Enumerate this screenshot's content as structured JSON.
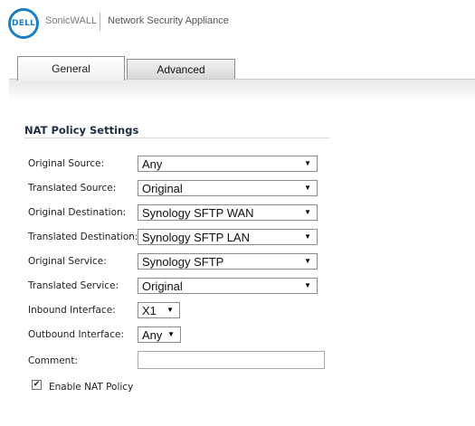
{
  "header": {
    "logo_text": "DELL",
    "brand": "SonicWALL",
    "product": "Network Security Appliance"
  },
  "tabs": [
    {
      "label": "General",
      "active": true
    },
    {
      "label": "Advanced",
      "active": false
    }
  ],
  "section": {
    "title": "NAT Policy Settings"
  },
  "fields": {
    "original_source": {
      "label": "Original Source:",
      "value": "Any"
    },
    "translated_source": {
      "label": "Translated Source:",
      "value": "Original"
    },
    "original_destination": {
      "label": "Original Destination:",
      "value": "Synology SFTP WAN"
    },
    "translated_destination": {
      "label": "Translated Destination:",
      "value": "Synology SFTP LAN"
    },
    "original_service": {
      "label": "Original Service:",
      "value": "Synology SFTP"
    },
    "translated_service": {
      "label": "Translated Service:",
      "value": "Original"
    },
    "inbound_interface": {
      "label": "Inbound Interface:",
      "value": "X1"
    },
    "outbound_interface": {
      "label": "Outbound Interface:",
      "value": "Any"
    },
    "comment": {
      "label": "Comment:",
      "value": ""
    }
  },
  "enable_nat": {
    "label": "Enable NAT Policy",
    "checked": true
  },
  "icons": {
    "dropdown_arrow": "chevron-down-icon",
    "checkbox_check": "check-icon"
  }
}
